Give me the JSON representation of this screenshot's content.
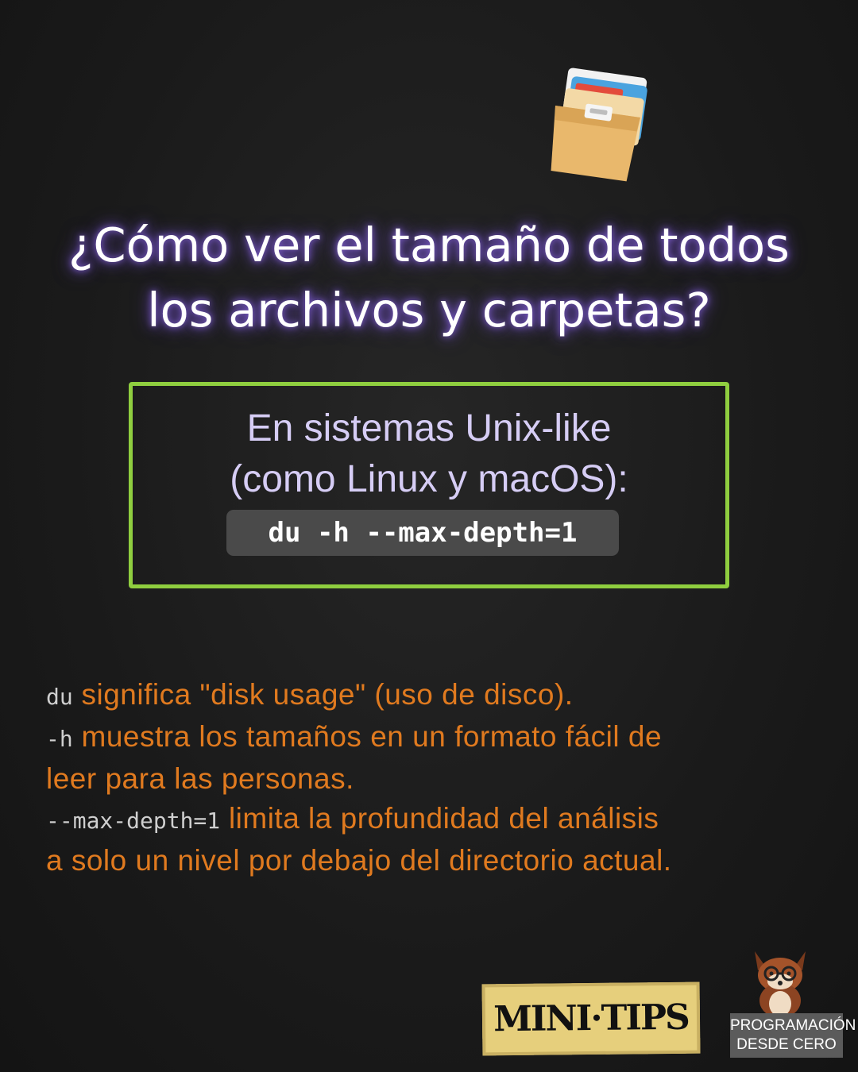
{
  "title": {
    "line1": "¿Cómo ver el tamaño de todos",
    "line2": "los archivos y carpetas?"
  },
  "unix_box": {
    "line1": "En sistemas Unix-like",
    "line2": "(como Linux y macOS):",
    "command": "du -h --max-depth=1"
  },
  "explanations": [
    {
      "code": "du",
      "text": "significa \"disk usage\" (uso de disco)."
    },
    {
      "code": "-h",
      "text": "muestra los tamaños en un formato fácil de",
      "cont": "leer para las personas."
    },
    {
      "code": "--max-depth=1",
      "text": "limita la profundidad del análisis",
      "cont": "a solo un nivel por debajo del directorio actual."
    }
  ],
  "badge": {
    "text": "MINI·TIPS"
  },
  "brand": {
    "line1": "PROGRAMACIÓN",
    "line2": "DESDE CERO"
  },
  "icons": {
    "folder": "file-cabinet-icon",
    "mascot": "fox-mascot-icon"
  },
  "colors": {
    "accent_green": "#8fce3f",
    "text_orange": "#e07a1f",
    "glow_purple": "#7b5cc9",
    "box_text": "#d6cdf5"
  }
}
